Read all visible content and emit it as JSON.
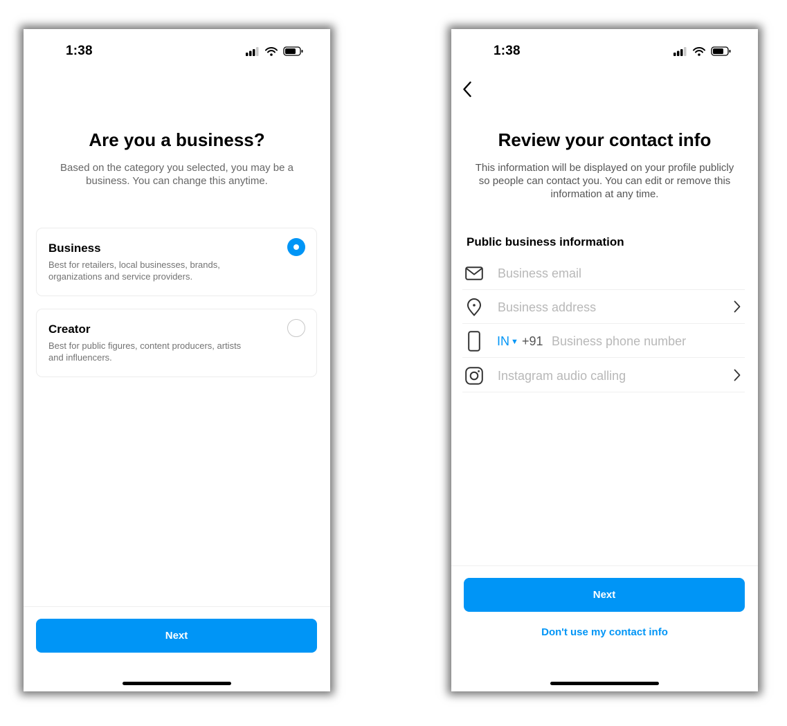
{
  "left_screen": {
    "status": {
      "time": "1:38"
    },
    "title": "Are you a business?",
    "subtitle": "Based on the category you selected, you may be a business. You can change this anytime.",
    "options": [
      {
        "title": "Business",
        "description": "Best for retailers, local businesses, brands, organizations and service providers.",
        "selected": true
      },
      {
        "title": "Creator",
        "description": "Best for public figures, content producers, artists and influencers.",
        "selected": false
      }
    ],
    "next_label": "Next"
  },
  "right_screen": {
    "status": {
      "time": "1:38"
    },
    "back_icon": "chevron-left-icon",
    "title": "Review your contact info",
    "subtitle": "This information will be displayed on your profile publicly so people can contact you. You can edit or remove this information at any time.",
    "section_title": "Public business information",
    "fields": {
      "email": {
        "placeholder": "Business email",
        "icon": "mail-icon"
      },
      "address": {
        "placeholder": "Business address",
        "icon": "location-pin-icon"
      },
      "phone": {
        "country": "IN",
        "dial_code": "+91",
        "placeholder": "Business phone number",
        "icon": "phone-icon"
      },
      "audio_calling": {
        "label": "Instagram audio calling",
        "icon": "instagram-icon"
      }
    },
    "next_label": "Next",
    "skip_label": "Don't use my contact info"
  },
  "colors": {
    "accent": "#0095f6",
    "placeholder": "#b8b8b8",
    "secondary_text": "#737373",
    "divider": "#efefef"
  }
}
